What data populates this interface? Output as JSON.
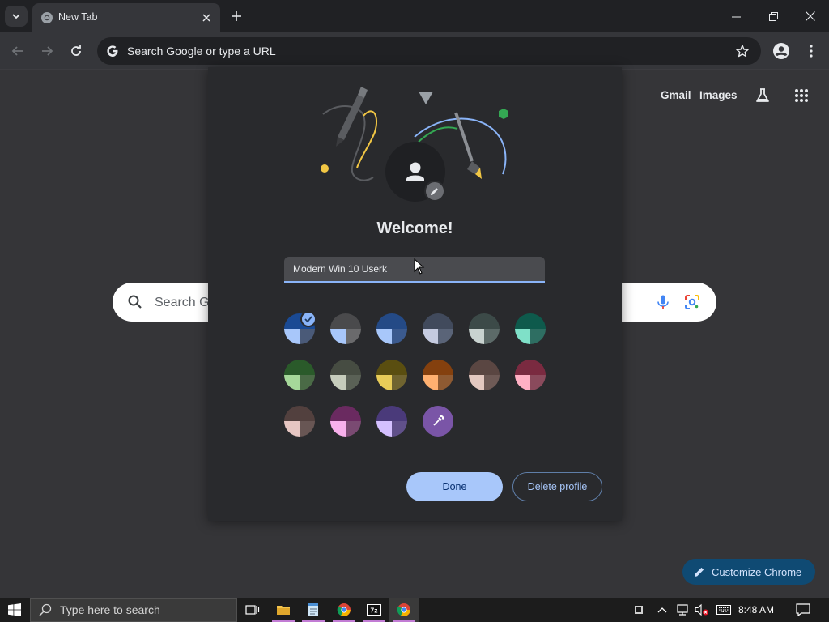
{
  "browser": {
    "tab_title": "New Tab",
    "omnibox_placeholder": "Search Google or type a URL"
  },
  "ntp": {
    "gmail": "Gmail",
    "images": "Images",
    "search_placeholder": "Search G",
    "customize_label": "Customize Chrome"
  },
  "dialog": {
    "welcome": "Welcome!",
    "profile_name": "Modern Win 10 Userk",
    "done_label": "Done",
    "delete_label": "Delete profile",
    "swatches": [
      {
        "top": "#1a4a94",
        "bl": "#a8c7fa",
        "br": "#4a5a78",
        "selected": true
      },
      {
        "top": "#4a4a4c",
        "bl": "#a8c7fa",
        "br": "#6a6a6c"
      },
      {
        "top": "#244a86",
        "bl": "#a8c7fa",
        "br": "#3b5a8e"
      },
      {
        "top": "#414a5c",
        "bl": "#c5cbe0",
        "br": "#5a6478"
      },
      {
        "top": "#3c4a48",
        "bl": "#c9d3d0",
        "br": "#5c6a68"
      },
      {
        "top": "#0e5a4c",
        "bl": "#7fe0c8",
        "br": "#2e6e62"
      },
      {
        "top": "#2a5a2a",
        "bl": "#a6d89a",
        "br": "#4a6a46"
      },
      {
        "top": "#464c42",
        "bl": "#c6cdbc",
        "br": "#5a6156"
      },
      {
        "top": "#5a4e10",
        "bl": "#e8cc58",
        "br": "#706430"
      },
      {
        "top": "#84400e",
        "bl": "#ffb070",
        "br": "#8e5a32"
      },
      {
        "top": "#5a4642",
        "bl": "#e3c8c0",
        "br": "#6e5a56"
      },
      {
        "top": "#7a2a40",
        "bl": "#ffb0c4",
        "br": "#8a4a5c"
      },
      {
        "top": "#52403e",
        "bl": "#e6c6c2",
        "br": "#685654"
      },
      {
        "top": "#6a2a60",
        "bl": "#f8b0ec",
        "br": "#7a4a72"
      },
      {
        "top": "#4a3a7a",
        "bl": "#d4c0ff",
        "br": "#60508a"
      }
    ]
  },
  "taskbar": {
    "search_placeholder": "Type here to search",
    "time": "8:48 AM"
  }
}
